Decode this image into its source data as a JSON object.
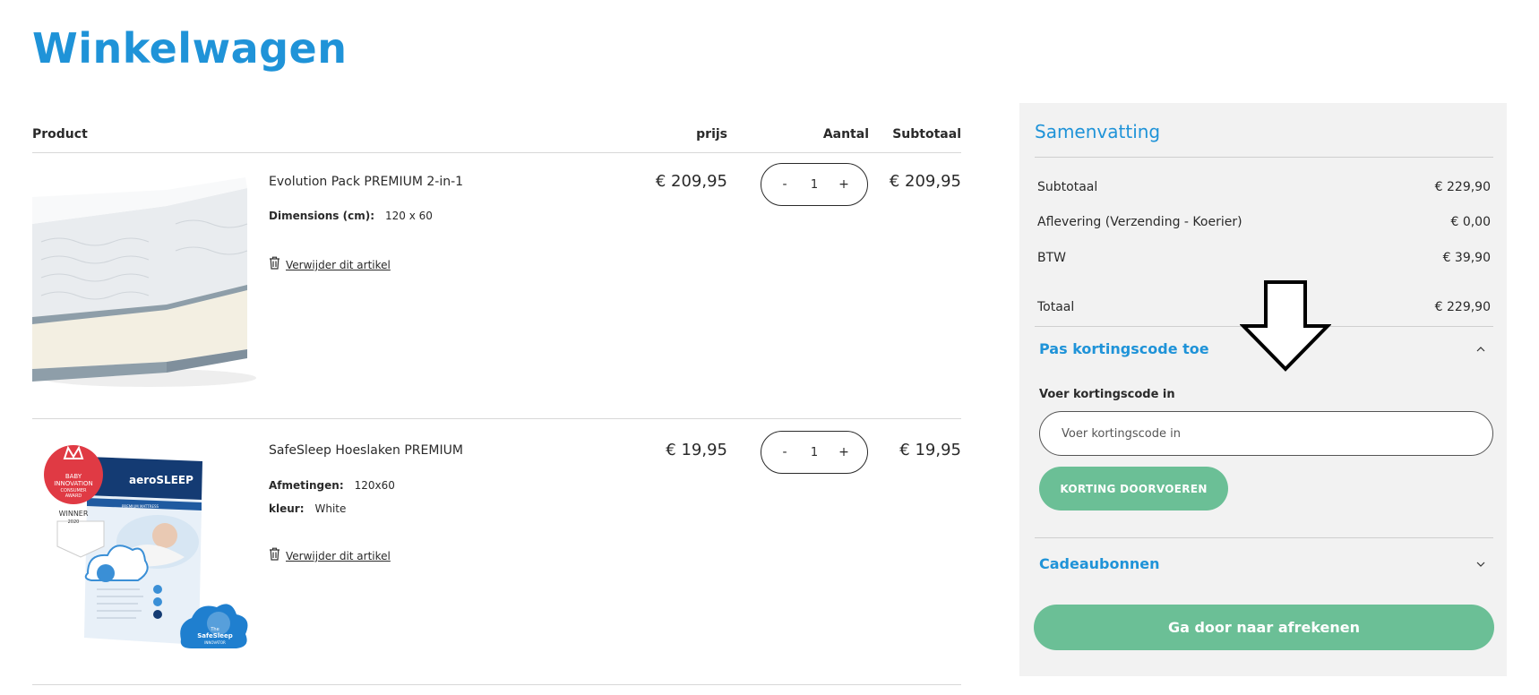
{
  "page": {
    "title": "Winkelwagen"
  },
  "table": {
    "headers": {
      "product": "Product",
      "prijs": "prijs",
      "aantal": "Aantal",
      "subtotaal": "Subtotaal"
    }
  },
  "items": [
    {
      "name": "Evolution Pack PREMIUM 2-in-1",
      "attributes": [
        {
          "key": "Dimensions (cm):",
          "value": "120 x 60"
        }
      ],
      "remove_label": "Verwijder dit artikel",
      "price": "€ 209,95",
      "qty": {
        "minus": "-",
        "value": "1",
        "plus": "+"
      },
      "subtotal": "€ 209,95"
    },
    {
      "name": "SafeSleep Hoeslaken PREMIUM",
      "attributes": [
        {
          "key": "Afmetingen:",
          "value": "120x60"
        },
        {
          "key": "kleur:",
          "value": "White"
        }
      ],
      "remove_label": "Verwijder dit artikel",
      "price": "€ 19,95",
      "qty": {
        "minus": "-",
        "value": "1",
        "plus": "+"
      },
      "subtotal": "€ 19,95",
      "image_text": {
        "brand": "aeroSLEEP",
        "award": [
          "BABY",
          "INNOVATION",
          "CONSUMER",
          "AWARD"
        ],
        "winner": "WINNER",
        "year": "2020",
        "badge": [
          "The",
          "SafeSleep",
          "INNOVATOR"
        ],
        "band": "PREMIUM MATTRESS"
      }
    }
  ],
  "summary": {
    "title": "Samenvatting",
    "rows": [
      {
        "label": "Subtotaal",
        "value": "€ 229,90"
      },
      {
        "label": "Aflevering (Verzending - Koerier)",
        "value": "€ 0,00"
      },
      {
        "label": "BTW",
        "value": "€ 39,90"
      },
      {
        "label": "Totaal",
        "value": "€ 229,90"
      }
    ],
    "discount": {
      "title": "Pas kortingscode toe",
      "input_label": "Voer kortingscode in",
      "input_placeholder": "Voer kortingscode in",
      "apply_label": "KORTING DOORVOEREN"
    },
    "giftcards": {
      "title": "Cadeaubonnen"
    },
    "checkout_label": "Ga door naar afrekenen"
  },
  "colors": {
    "accent": "#1f93d8",
    "button": "#6bbf96",
    "panel": "#f2f2f2"
  },
  "icons": [
    "trash-icon",
    "chevron-up-icon",
    "chevron-down-icon",
    "down-arrow-annotation-icon"
  ]
}
